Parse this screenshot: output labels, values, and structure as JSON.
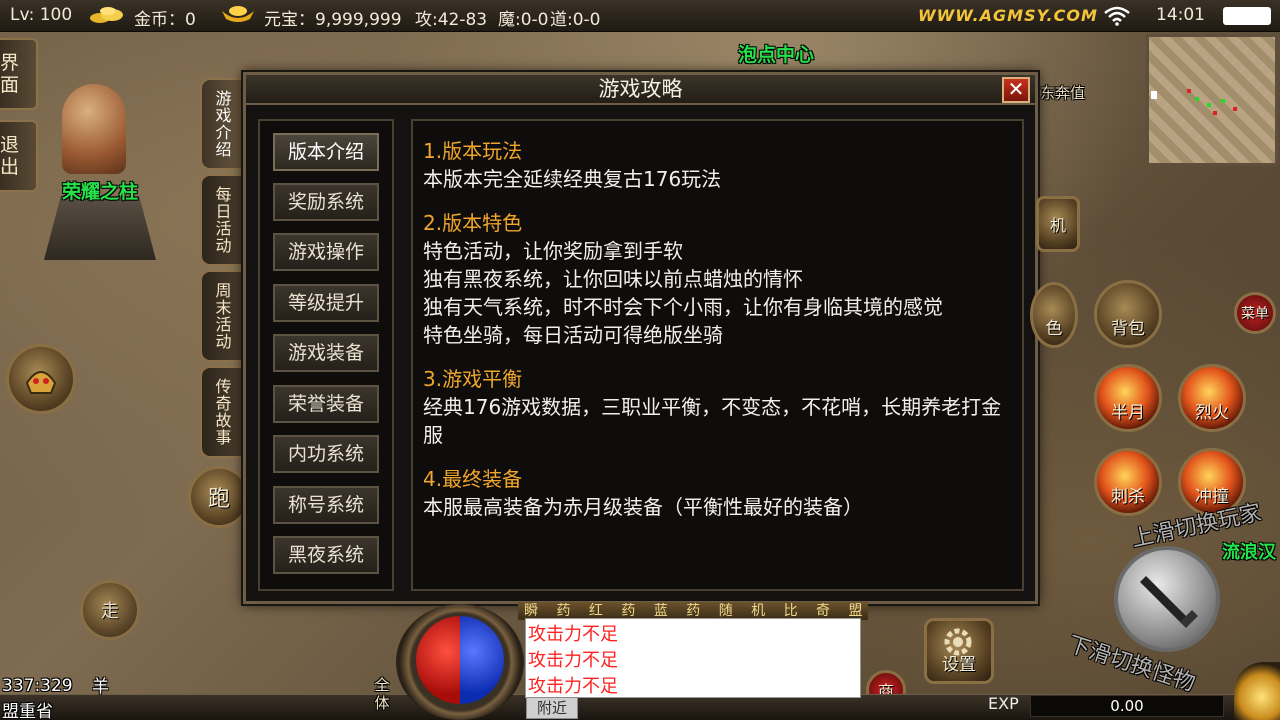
{
  "status_bar": {
    "level": "Lv: 100",
    "gold": "金币：0",
    "yuanbao": "元宝：9,999,999",
    "attack": "攻:42-83",
    "magic": "魔:0-0",
    "tao": "道:0-0",
    "site": "WWW.AGMSY.COM",
    "time": "14:01"
  },
  "scene": {
    "pillar_label": "荣耀之柱",
    "npc_label": "泡点中心",
    "npc2_label": "流浪汉",
    "npc3_label": "东奔值",
    "coords": "337:329",
    "monster": "羊",
    "region": "盟重省"
  },
  "left_buttons": [
    "界面",
    "退出"
  ],
  "side_tabs": [
    "游戏介绍",
    "每日活动",
    "周末活动",
    "传奇故事"
  ],
  "dialog": {
    "title": "游戏攻略",
    "close": "✕",
    "menu": [
      "版本介绍",
      "奖励系统",
      "游戏操作",
      "等级提升",
      "游戏装备",
      "荣誉装备",
      "内功系统",
      "称号系统",
      "黑夜系统"
    ],
    "sections": [
      {
        "title": "1.版本玩法",
        "lines": [
          "本版本完全延续经典复古176玩法"
        ]
      },
      {
        "title": "2.版本特色",
        "lines": [
          "特色活动，让你奖励拿到手软",
          "独有黑夜系统，让你回味以前点蜡烛的情怀",
          "独有天气系统，时不时会下个小雨，让你有身临其境的感觉",
          "特色坐骑，每日活动可得绝版坐骑"
        ]
      },
      {
        "title": "3.游戏平衡",
        "lines": [
          "经典176游戏数据，三职业平衡，不变态，不花哨，长期养老打金",
          "服"
        ]
      },
      {
        "title": "4.最终装备",
        "lines": [
          "本服最高装备为赤月级装备（平衡性最好的装备）"
        ]
      }
    ]
  },
  "skills": {
    "bag": "背包",
    "half_moon": "半月",
    "fire": "烈火",
    "stab": "刺杀",
    "charge": "冲撞",
    "menu": "菜单",
    "machine": "机",
    "color": "色",
    "settings": "设置",
    "shop": "商",
    "run": "跑",
    "walk": "走",
    "swipe_up": "上滑切换玩家",
    "swipe_down": "下滑切换怪物"
  },
  "hud": {
    "chat_scope": "全体",
    "chat_tab": "附近",
    "item_strip": "瞬 药 红 药 蓝 药 随 机 比 奇 盟 重",
    "chat_lines": [
      "攻击力不足",
      "攻击力不足",
      "攻击力不足"
    ],
    "exp_label": "EXP",
    "exp_value": "0.00"
  },
  "colors": {
    "accent_gold": "#f0a52c",
    "npc_green": "#25e34a",
    "close_red": "#c7321f"
  }
}
